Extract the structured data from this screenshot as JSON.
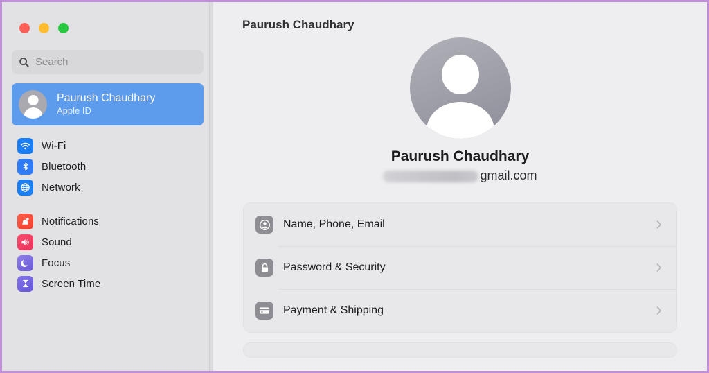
{
  "window": {
    "traffic_lights": [
      {
        "name": "close",
        "color": "#ff5f57"
      },
      {
        "name": "minimize",
        "color": "#febc2e"
      },
      {
        "name": "zoom",
        "color": "#28c840"
      }
    ],
    "border_color": "#c08fd8"
  },
  "sidebar": {
    "search": {
      "value": "",
      "placeholder": "Search",
      "icon": "search-icon"
    },
    "account": {
      "name": "Paurush Chaudhary",
      "subtitle": "Apple ID",
      "avatar_icon": "person-avatar-icon",
      "selected": true,
      "highlight_color": "#5d9cec"
    },
    "groups": [
      {
        "items": [
          {
            "label": "Wi-Fi",
            "icon": "wifi-icon",
            "color": "#1c7ef3"
          },
          {
            "label": "Bluetooth",
            "icon": "bluetooth-icon",
            "color": "#2f7cf6"
          },
          {
            "label": "Network",
            "icon": "globe-icon",
            "color": "#1b7ef2"
          }
        ]
      },
      {
        "items": [
          {
            "label": "Notifications",
            "icon": "bell-icon",
            "color": "#f64734"
          },
          {
            "label": "Sound",
            "icon": "speaker-icon",
            "color": "#f4405f"
          },
          {
            "label": "Focus",
            "icon": "moon-icon",
            "color": "#7b6ae0"
          },
          {
            "label": "Screen Time",
            "icon": "hourglass-icon",
            "color": "#6f60e0"
          }
        ]
      }
    ]
  },
  "main": {
    "page_title": "Paurush Chaudhary",
    "profile": {
      "avatar_icon": "person-avatar-icon",
      "name": "Paurush Chaudhary",
      "email_redacted": true,
      "email_visible_part": "gmail.com"
    },
    "cards": [
      {
        "rows": [
          {
            "label": "Name, Phone, Email",
            "icon": "person-circle-icon",
            "chevron": "chevron-right-icon"
          },
          {
            "label": "Password & Security",
            "icon": "lock-icon",
            "chevron": "chevron-right-icon"
          },
          {
            "label": "Payment & Shipping",
            "icon": "credit-card-icon",
            "chevron": "chevron-right-icon"
          }
        ]
      }
    ]
  }
}
